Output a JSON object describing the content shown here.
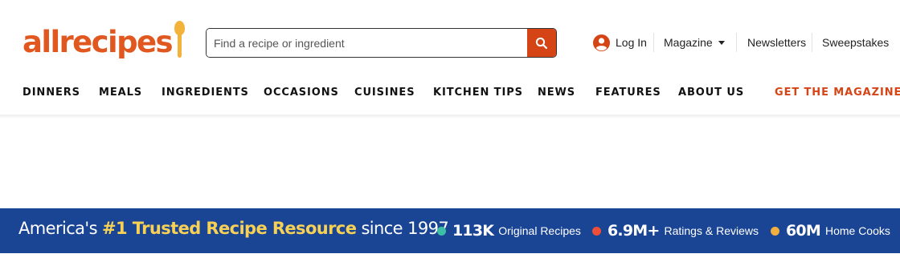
{
  "brand": {
    "name": "allrecipes",
    "primary_color": "#e0581f",
    "spoon_color": "#f3b23a"
  },
  "search": {
    "placeholder": "Find a recipe or ingredient",
    "value": "",
    "button_icon": "search-icon",
    "button_color": "#d54415"
  },
  "utility_nav": {
    "login": {
      "icon": "user-icon",
      "label": "Log In"
    },
    "magazine": {
      "label": "Magazine",
      "icon": "caret-down-icon"
    },
    "newsletters": {
      "label": "Newsletters"
    },
    "sweepstakes": {
      "label": "Sweepstakes"
    }
  },
  "main_nav": {
    "items": [
      {
        "label": "DINNERS"
      },
      {
        "label": "MEALS"
      },
      {
        "label": "INGREDIENTS"
      },
      {
        "label": "OCCASIONS"
      },
      {
        "label": "CUISINES"
      },
      {
        "label": "KITCHEN TIPS"
      },
      {
        "label": "NEWS"
      },
      {
        "label": "FEATURES"
      },
      {
        "label": "ABOUT US"
      }
    ],
    "cta": {
      "label": "GET THE MAGAZINE",
      "color": "#d54415"
    }
  },
  "banner": {
    "background": "#1a4494",
    "headline_prefix": "America's ",
    "headline_highlight": "#1 Trusted Recipe Resource",
    "headline_suffix": " since 1997",
    "highlight_color": "#f7d155",
    "stats": [
      {
        "value": "113K",
        "label": "Original Recipes",
        "dot_color": "#3cbfa5"
      },
      {
        "value": "6.9M+",
        "label": "Ratings & Reviews",
        "dot_color": "#ee4f36"
      },
      {
        "value": "60M",
        "label": "Home Cooks",
        "dot_color": "#f2ae3f"
      }
    ]
  }
}
